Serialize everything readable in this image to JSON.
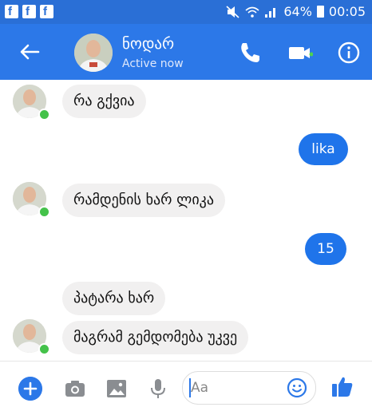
{
  "status_bar": {
    "battery": "64%",
    "time": "00:05",
    "notification_icons": [
      "facebook-icon",
      "facebook-icon",
      "facebook-icon"
    ]
  },
  "header": {
    "contact_name": "ნოდარ",
    "status": "Active now",
    "accent_color": "#2c78e8"
  },
  "messages": [
    {
      "from": "contact",
      "text": "რა გქვია"
    },
    {
      "from": "me",
      "text": "lika"
    },
    {
      "from": "contact",
      "text": "რამდენის ხარ ლიკა"
    },
    {
      "from": "me",
      "text": "15"
    },
    {
      "from": "contact",
      "text": "პატარა ხარ"
    },
    {
      "from": "contact",
      "text": "მაგრამ გემდომება უკვე"
    }
  ],
  "composer": {
    "placeholder": "Aa"
  }
}
